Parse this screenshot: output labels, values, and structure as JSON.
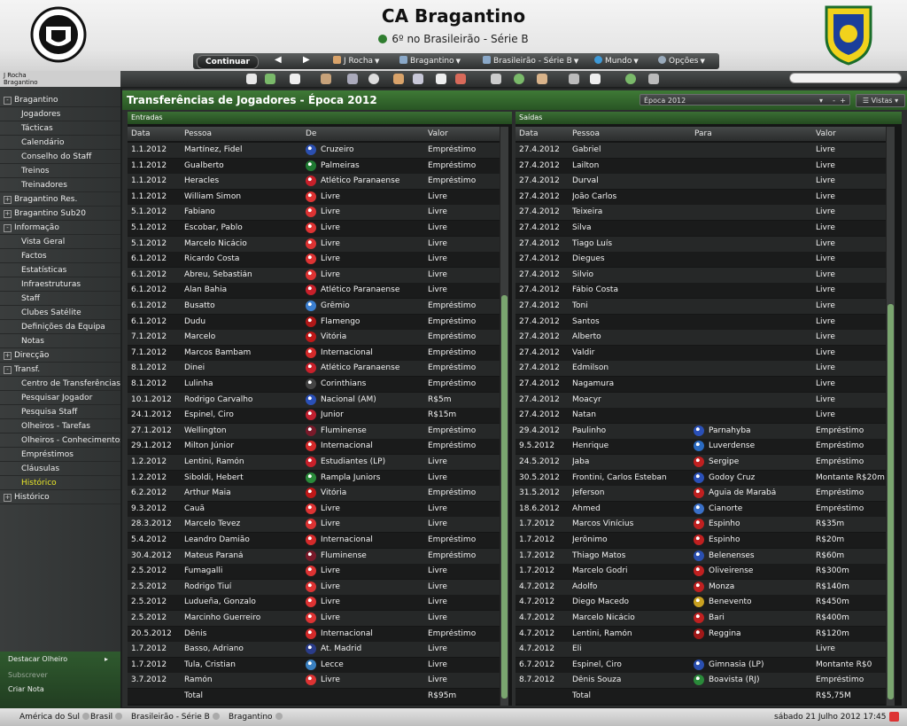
{
  "header": {
    "club_name": "CA Bragantino",
    "status": "6º no Brasileirão - Série B",
    "club_crest_icon": "club-crest-bragantino",
    "federation_crest_icon": "cbf-crest"
  },
  "nav": {
    "continue": "Continuar",
    "manager": "J Rocha",
    "club": "Bragantino",
    "competition": "Brasileirão - Série B",
    "world": "Mundo",
    "options": "Opções"
  },
  "manager_info": {
    "line1": "J Rocha",
    "line2": "Bragantino"
  },
  "sidebar": {
    "items": [
      {
        "label": "Bragantino",
        "type": "top",
        "expander": "-"
      },
      {
        "label": "Jogadores",
        "type": "child"
      },
      {
        "label": "Tácticas",
        "type": "child"
      },
      {
        "label": "Calendário",
        "type": "child"
      },
      {
        "label": "Conselho do Staff",
        "type": "child"
      },
      {
        "label": "Treinos",
        "type": "child"
      },
      {
        "label": "Treinadores",
        "type": "child"
      },
      {
        "label": "Bragantino Res.",
        "type": "top",
        "expander": "+"
      },
      {
        "label": "Bragantino Sub20",
        "type": "top",
        "expander": "+"
      },
      {
        "label": "Informação",
        "type": "top",
        "expander": "-"
      },
      {
        "label": "Vista Geral",
        "type": "child"
      },
      {
        "label": "Factos",
        "type": "child"
      },
      {
        "label": "Estatísticas",
        "type": "child"
      },
      {
        "label": "Infraestruturas",
        "type": "child"
      },
      {
        "label": "Staff",
        "type": "child"
      },
      {
        "label": "Clubes Satélite",
        "type": "child"
      },
      {
        "label": "Definições da Equipa",
        "type": "child"
      },
      {
        "label": "Notas",
        "type": "child"
      },
      {
        "label": "Direcção",
        "type": "top",
        "expander": "+"
      },
      {
        "label": "Transf.",
        "type": "top",
        "expander": "-"
      },
      {
        "label": "Centro de Transferências",
        "type": "child"
      },
      {
        "label": "Pesquisar Jogador",
        "type": "child"
      },
      {
        "label": "Pesquisa Staff",
        "type": "child"
      },
      {
        "label": "Olheiros - Tarefas",
        "type": "child"
      },
      {
        "label": "Olheiros - Conhecimentos",
        "type": "child"
      },
      {
        "label": "Empréstimos",
        "type": "child"
      },
      {
        "label": "Cláusulas",
        "type": "child"
      },
      {
        "label": "Histórico",
        "type": "child",
        "active": true
      },
      {
        "label": "Histórico",
        "type": "top",
        "expander": "+"
      }
    ],
    "bottom": {
      "scout": "Destacar Olheiro",
      "subscribe": "Subscrever",
      "note": "Criar Nota"
    }
  },
  "panel": {
    "title": "Transferências de Jogadores - Época 2012",
    "season": "Época 2012",
    "views": "Vistas"
  },
  "incoming": {
    "caption": "Entradas",
    "headers": {
      "date": "Data",
      "person": "Pessoa",
      "from": "De",
      "value": "Valor"
    },
    "rows": [
      {
        "date": "1.1.2012",
        "person": "Martínez, Fidel",
        "club": "Cruzeiro",
        "value": "Empréstimo",
        "color": "#2b4fb0"
      },
      {
        "date": "1.1.2012",
        "person": "Gualberto",
        "club": "Palmeiras",
        "value": "Empréstimo",
        "color": "#1f7a32"
      },
      {
        "date": "1.1.2012",
        "person": "Heracles",
        "club": "Atlético Paranaense",
        "value": "Empréstimo",
        "color": "#c8202a"
      },
      {
        "date": "1.1.2012",
        "person": "William Simon",
        "club": "Livre",
        "value": "Livre",
        "color": "#d33"
      },
      {
        "date": "5.1.2012",
        "person": "Fabiano",
        "club": "Livre",
        "value": "Livre",
        "color": "#d33"
      },
      {
        "date": "5.1.2012",
        "person": "Escobar, Pablo",
        "club": "Livre",
        "value": "Livre",
        "color": "#d33"
      },
      {
        "date": "5.1.2012",
        "person": "Marcelo Nicácio",
        "club": "Livre",
        "value": "Livre",
        "color": "#d33"
      },
      {
        "date": "6.1.2012",
        "person": "Ricardo Costa",
        "club": "Livre",
        "value": "Livre",
        "color": "#d33"
      },
      {
        "date": "6.1.2012",
        "person": "Abreu, Sebastián",
        "club": "Livre",
        "value": "Livre",
        "color": "#d33"
      },
      {
        "date": "6.1.2012",
        "person": "Alan Bahia",
        "club": "Atlético Paranaense",
        "value": "Livre",
        "color": "#c8202a"
      },
      {
        "date": "6.1.2012",
        "person": "Busatto",
        "club": "Grêmio",
        "value": "Empréstimo",
        "color": "#3b7fd0"
      },
      {
        "date": "6.1.2012",
        "person": "Dudu",
        "club": "Flamengo",
        "value": "Empréstimo",
        "color": "#b01818"
      },
      {
        "date": "7.1.2012",
        "person": "Marcelo",
        "club": "Vitória",
        "value": "Empréstimo",
        "color": "#c01818"
      },
      {
        "date": "7.1.2012",
        "person": "Marcos Bambam",
        "club": "Internacional",
        "value": "Empréstimo",
        "color": "#d42a2a"
      },
      {
        "date": "8.1.2012",
        "person": "Dinei",
        "club": "Atlético Paranaense",
        "value": "Empréstimo",
        "color": "#c8202a"
      },
      {
        "date": "8.1.2012",
        "person": "Lulinha",
        "club": "Corinthians",
        "value": "Empréstimo",
        "color": "#444"
      },
      {
        "date": "10.1.2012",
        "person": "Rodrigo Carvalho",
        "club": "Nacional (AM)",
        "value": "R$5m",
        "color": "#2a50b8"
      },
      {
        "date": "24.1.2012",
        "person": "Espinel, Ciro",
        "club": "Junior",
        "value": "R$15m",
        "color": "#c02030"
      },
      {
        "date": "27.1.2012",
        "person": "Wellington",
        "club": "Fluminense",
        "value": "Empréstimo",
        "color": "#7a1a2a"
      },
      {
        "date": "29.1.2012",
        "person": "Milton Júnior",
        "club": "Internacional",
        "value": "Empréstimo",
        "color": "#d42a2a"
      },
      {
        "date": "1.2.2012",
        "person": "Lentini, Ramón",
        "club": "Estudiantes (LP)",
        "value": "Livre",
        "color": "#c8202a"
      },
      {
        "date": "1.2.2012",
        "person": "Siboldi, Hebert",
        "club": "Rampla Juniors",
        "value": "Livre",
        "color": "#2a8a3a"
      },
      {
        "date": "6.2.2012",
        "person": "Arthur Maia",
        "club": "Vitória",
        "value": "Empréstimo",
        "color": "#c01818"
      },
      {
        "date": "9.3.2012",
        "person": "Cauã",
        "club": "Livre",
        "value": "Livre",
        "color": "#d33"
      },
      {
        "date": "28.3.2012",
        "person": "Marcelo Tevez",
        "club": "Livre",
        "value": "Livre",
        "color": "#d33"
      },
      {
        "date": "5.4.2012",
        "person": "Leandro Damião",
        "club": "Internacional",
        "value": "Empréstimo",
        "color": "#d42a2a"
      },
      {
        "date": "30.4.2012",
        "person": "Mateus Paraná",
        "club": "Fluminense",
        "value": "Empréstimo",
        "color": "#7a1a2a"
      },
      {
        "date": "2.5.2012",
        "person": "Fumagalli",
        "club": "Livre",
        "value": "Livre",
        "color": "#d33"
      },
      {
        "date": "2.5.2012",
        "person": "Rodrigo Tiuí",
        "club": "Livre",
        "value": "Livre",
        "color": "#d33"
      },
      {
        "date": "2.5.2012",
        "person": "Ludueña, Gonzalo",
        "club": "Livre",
        "value": "Livre",
        "color": "#d33"
      },
      {
        "date": "2.5.2012",
        "person": "Marcinho Guerreiro",
        "club": "Livre",
        "value": "Livre",
        "color": "#d33"
      },
      {
        "date": "20.5.2012",
        "person": "Dênis",
        "club": "Internacional",
        "value": "Empréstimo",
        "color": "#d42a2a"
      },
      {
        "date": "1.7.2012",
        "person": "Basso, Adriano",
        "club": "At. Madrid",
        "value": "Livre",
        "color": "#2a3c8a"
      },
      {
        "date": "1.7.2012",
        "person": "Tula, Cristian",
        "club": "Lecce",
        "value": "Livre",
        "color": "#3a80c0"
      },
      {
        "date": "3.7.2012",
        "person": "Ramón",
        "club": "Livre",
        "value": "Livre",
        "color": "#d33"
      }
    ],
    "total_label": "Total",
    "total_value": "R$95m"
  },
  "outgoing": {
    "caption": "Saídas",
    "headers": {
      "date": "Data",
      "person": "Pessoa",
      "to": "Para",
      "value": "Valor"
    },
    "rows": [
      {
        "date": "27.4.2012",
        "person": "Gabriel",
        "club": "",
        "value": "Livre"
      },
      {
        "date": "27.4.2012",
        "person": "Lailton",
        "club": "",
        "value": "Livre"
      },
      {
        "date": "27.4.2012",
        "person": "Durval",
        "club": "",
        "value": "Livre"
      },
      {
        "date": "27.4.2012",
        "person": "João Carlos",
        "club": "",
        "value": "Livre"
      },
      {
        "date": "27.4.2012",
        "person": "Teixeira",
        "club": "",
        "value": "Livre"
      },
      {
        "date": "27.4.2012",
        "person": "Silva",
        "club": "",
        "value": "Livre"
      },
      {
        "date": "27.4.2012",
        "person": "Tiago Luís",
        "club": "",
        "value": "Livre"
      },
      {
        "date": "27.4.2012",
        "person": "Diegues",
        "club": "",
        "value": "Livre"
      },
      {
        "date": "27.4.2012",
        "person": "Silvio",
        "club": "",
        "value": "Livre"
      },
      {
        "date": "27.4.2012",
        "person": "Fábio Costa",
        "club": "",
        "value": "Livre"
      },
      {
        "date": "27.4.2012",
        "person": "Toni",
        "club": "",
        "value": "Livre"
      },
      {
        "date": "27.4.2012",
        "person": "Santos",
        "club": "",
        "value": "Livre"
      },
      {
        "date": "27.4.2012",
        "person": "Alberto",
        "club": "",
        "value": "Livre"
      },
      {
        "date": "27.4.2012",
        "person": "Valdir",
        "club": "",
        "value": "Livre"
      },
      {
        "date": "27.4.2012",
        "person": "Edmilson",
        "club": "",
        "value": "Livre"
      },
      {
        "date": "27.4.2012",
        "person": "Nagamura",
        "club": "",
        "value": "Livre"
      },
      {
        "date": "27.4.2012",
        "person": "Moacyr",
        "club": "",
        "value": "Livre"
      },
      {
        "date": "27.4.2012",
        "person": "Natan",
        "club": "",
        "value": "Livre"
      },
      {
        "date": "29.4.2012",
        "person": "Paulinho",
        "club": "Parnahyba",
        "value": "Empréstimo",
        "color": "#2a50b8"
      },
      {
        "date": "9.5.2012",
        "person": "Henrique",
        "club": "Luverdense",
        "value": "Empréstimo",
        "color": "#2a6ac0"
      },
      {
        "date": "24.5.2012",
        "person": "Jaba",
        "club": "Sergipe",
        "value": "Empréstimo",
        "color": "#c02020"
      },
      {
        "date": "30.5.2012",
        "person": "Frontini, Carlos Esteban",
        "club": "Godoy Cruz",
        "value": "Montante R$20m",
        "color": "#2a50b8"
      },
      {
        "date": "31.5.2012",
        "person": "Jeferson",
        "club": "Águia de Marabá",
        "value": "Empréstimo",
        "color": "#c02020"
      },
      {
        "date": "18.6.2012",
        "person": "Ahmed",
        "club": "Cianorte",
        "value": "Empréstimo",
        "color": "#3a70c8"
      },
      {
        "date": "1.7.2012",
        "person": "Marcos Vinícius",
        "club": "Espinho",
        "value": "R$35m",
        "color": "#c02020"
      },
      {
        "date": "1.7.2012",
        "person": "Jerônimo",
        "club": "Espinho",
        "value": "R$20m",
        "color": "#c02020"
      },
      {
        "date": "1.7.2012",
        "person": "Thiago Matos",
        "club": "Belenenses",
        "value": "R$60m",
        "color": "#2a4fb0"
      },
      {
        "date": "1.7.2012",
        "person": "Marcelo Godri",
        "club": "Oliveirense",
        "value": "R$300m",
        "color": "#c02020"
      },
      {
        "date": "4.7.2012",
        "person": "Adolfo",
        "club": "Monza",
        "value": "R$140m",
        "color": "#c02020"
      },
      {
        "date": "4.7.2012",
        "person": "Diego Macedo",
        "club": "Benevento",
        "value": "R$450m",
        "color": "#c8a020"
      },
      {
        "date": "4.7.2012",
        "person": "Marcelo Nicácio",
        "club": "Bari",
        "value": "R$400m",
        "color": "#c02020"
      },
      {
        "date": "4.7.2012",
        "person": "Lentini, Ramón",
        "club": "Reggina",
        "value": "R$120m",
        "color": "#a01818"
      },
      {
        "date": "4.7.2012",
        "person": "Eli",
        "club": "",
        "value": "Livre"
      },
      {
        "date": "6.7.2012",
        "person": "Espinel, Ciro",
        "club": "Gimnasia (LP)",
        "value": "Montante R$0",
        "color": "#2a4fb0"
      },
      {
        "date": "8.7.2012",
        "person": "Dênis Souza",
        "club": "Boavista (RJ)",
        "value": "Empréstimo",
        "color": "#2a8a3a"
      }
    ],
    "total_label": "Total",
    "total_value": "R$5,75M"
  },
  "statusbar": {
    "crumbs": [
      "América do Sul",
      "Brasil",
      "Brasileirão - Série B",
      "Bragantino"
    ],
    "datetime": "sábado 21 Julho 2012 17:45"
  }
}
